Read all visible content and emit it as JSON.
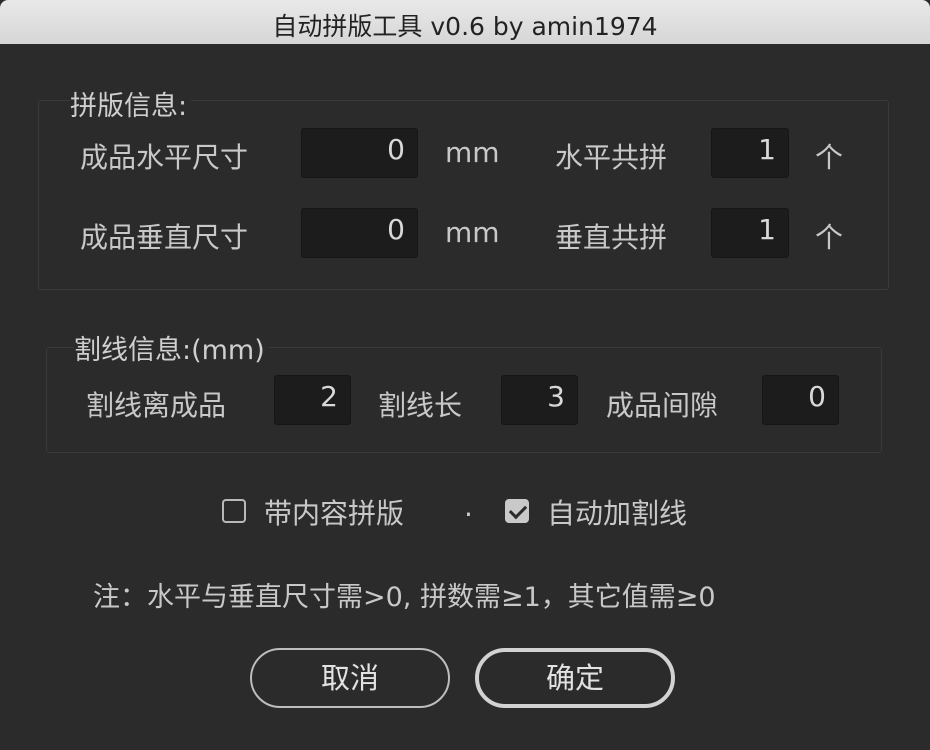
{
  "window": {
    "title": "自动拼版工具 v0.6   by amin1974"
  },
  "layout_info": {
    "title": "拼版信息:",
    "width_label": "成品水平尺寸",
    "width_value": "0",
    "width_unit": "mm",
    "h_count_label": "水平共拼",
    "h_count_value": "1",
    "h_count_unit": "个",
    "height_label": "成品垂直尺寸",
    "height_value": "0",
    "height_unit": "mm",
    "v_count_label": "垂直共拼",
    "v_count_value": "1",
    "v_count_unit": "个"
  },
  "cut_info": {
    "title": "割线信息:(mm)",
    "offset_label": "割线离成品",
    "offset_value": "2",
    "length_label": "割线长",
    "length_value": "3",
    "gap_label": "成品间隙",
    "gap_value": "0"
  },
  "options": {
    "with_content_label": "带内容拼版",
    "with_content_checked": false,
    "separator": ".",
    "auto_cut_label": "自动加割线",
    "auto_cut_checked": true
  },
  "note": "注：水平与垂直尺寸需>0, 拼数需≥1，其它值需≥0",
  "buttons": {
    "cancel": "取消",
    "ok": "确定"
  }
}
